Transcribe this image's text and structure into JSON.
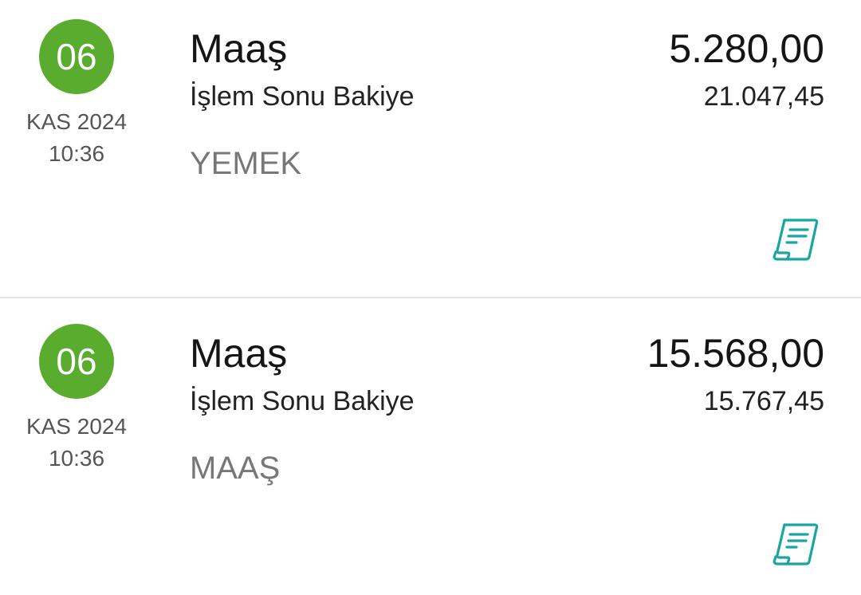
{
  "transactions": [
    {
      "day": "06",
      "month_year": "KAS 2024",
      "time": "10:36",
      "title": "Maaş",
      "subtitle": "İşlem Sonu Bakiye",
      "category": "YEMEK",
      "amount": "5.280,00",
      "balance": "21.047,45",
      "receipt_icon": "receipt-icon"
    },
    {
      "day": "06",
      "month_year": "KAS 2024",
      "time": "10:36",
      "title": "Maaş",
      "subtitle": "İşlem Sonu Bakiye",
      "category": "MAAŞ",
      "amount": "15.568,00",
      "balance": "15.767,45",
      "receipt_icon": "receipt-icon"
    }
  ],
  "colors": {
    "badge": "#5aac2e",
    "receipt_icon": "#1aa6a0",
    "category_text": "#777777"
  }
}
